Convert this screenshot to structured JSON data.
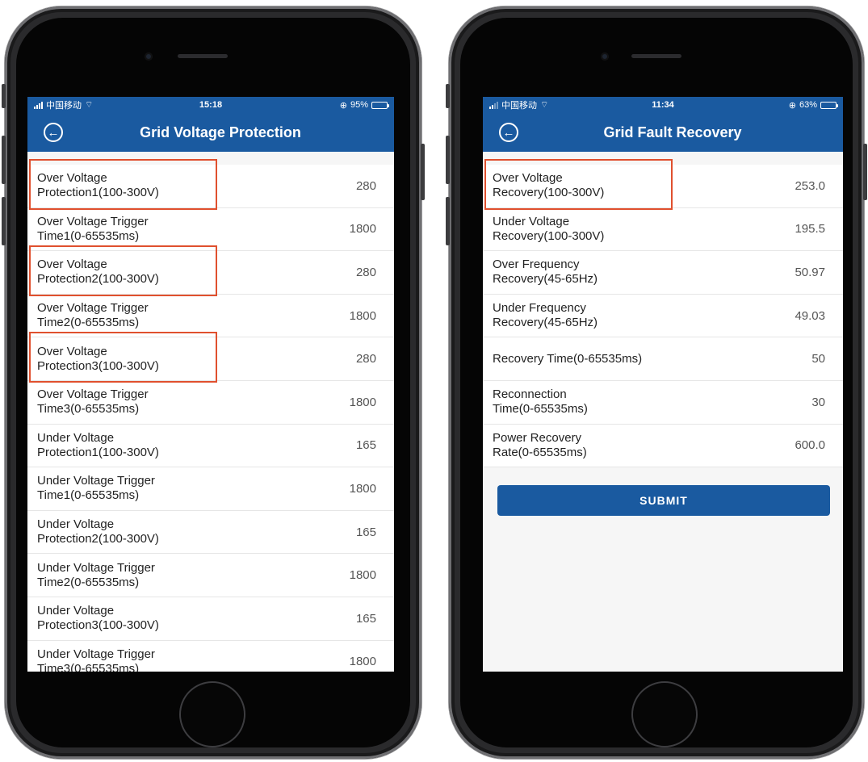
{
  "left_phone": {
    "status": {
      "carrier": "中国移动",
      "time": "15:18",
      "battery": "95%",
      "battery_level": 0.95
    },
    "nav": {
      "back_icon": "back-arrow-circle-icon",
      "title": "Grid Voltage Protection"
    },
    "rows": [
      {
        "label_line1": "Over Voltage",
        "label_line2": "Protection1(100-300V)",
        "value": "280",
        "highlighted": true
      },
      {
        "label_line1": "Over Voltage Trigger",
        "label_line2": "Time1(0-65535ms)",
        "value": "1800",
        "highlighted": false
      },
      {
        "label_line1": "Over Voltage",
        "label_line2": "Protection2(100-300V)",
        "value": "280",
        "highlighted": true
      },
      {
        "label_line1": "Over Voltage Trigger",
        "label_line2": "Time2(0-65535ms)",
        "value": "1800",
        "highlighted": false
      },
      {
        "label_line1": "Over Voltage",
        "label_line2": "Protection3(100-300V)",
        "value": "280",
        "highlighted": true
      },
      {
        "label_line1": "Over Voltage Trigger",
        "label_line2": "Time3(0-65535ms)",
        "value": "1800",
        "highlighted": false
      },
      {
        "label_line1": "Under Voltage",
        "label_line2": "Protection1(100-300V)",
        "value": "165",
        "highlighted": false
      },
      {
        "label_line1": "Under Voltage Trigger",
        "label_line2": "Time1(0-65535ms)",
        "value": "1800",
        "highlighted": false
      },
      {
        "label_line1": "Under Voltage",
        "label_line2": "Protection2(100-300V)",
        "value": "165",
        "highlighted": false
      },
      {
        "label_line1": "Under Voltage Trigger",
        "label_line2": "Time2(0-65535ms)",
        "value": "1800",
        "highlighted": false
      },
      {
        "label_line1": "Under Voltage",
        "label_line2": "Protection3(100-300V)",
        "value": "165",
        "highlighted": false
      },
      {
        "label_line1": "Under Voltage Trigger",
        "label_line2": "Time3(0-65535ms)",
        "value": "1800",
        "highlighted": false
      }
    ]
  },
  "right_phone": {
    "status": {
      "carrier": "中国移动",
      "time": "11:34",
      "battery": "63%",
      "battery_level": 0.63
    },
    "nav": {
      "back_icon": "back-arrow-circle-icon",
      "title": "Grid Fault Recovery"
    },
    "rows": [
      {
        "label_line1": "Over Voltage",
        "label_line2": "Recovery(100-300V)",
        "value": "253.0",
        "highlighted": true
      },
      {
        "label_line1": "Under Voltage",
        "label_line2": "Recovery(100-300V)",
        "value": "195.5",
        "highlighted": false
      },
      {
        "label_line1": "Over Frequency",
        "label_line2": "Recovery(45-65Hz)",
        "value": "50.97",
        "highlighted": false
      },
      {
        "label_line1": "Under Frequency",
        "label_line2": "Recovery(45-65Hz)",
        "value": "49.03",
        "highlighted": false
      },
      {
        "label_line1": "Recovery Time(0-65535ms)",
        "label_line2": "",
        "value": "50",
        "highlighted": false
      },
      {
        "label_line1": "Reconnection",
        "label_line2": "Time(0-65535ms)",
        "value": "30",
        "highlighted": false
      },
      {
        "label_line1": "Power Recovery",
        "label_line2": "Rate(0-65535ms)",
        "value": "600.0",
        "highlighted": false
      }
    ],
    "submit_label": "SUBMIT"
  },
  "colors": {
    "accent": "#1a5aa0",
    "highlight_box": "#e0502e"
  }
}
